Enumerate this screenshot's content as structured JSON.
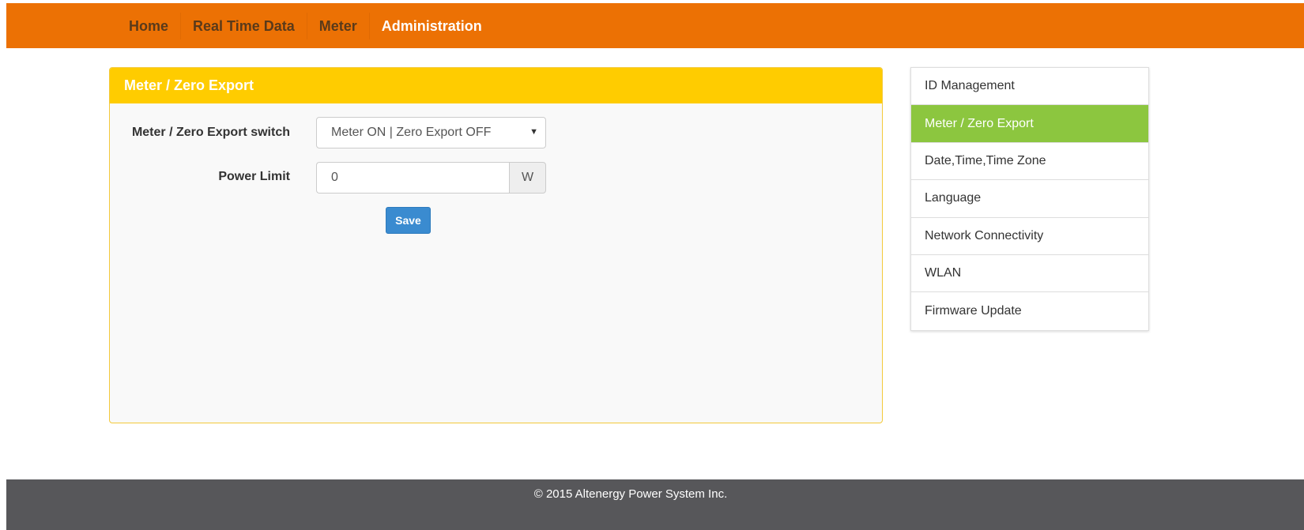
{
  "nav": {
    "items": [
      {
        "label": "Home"
      },
      {
        "label": "Real Time Data"
      },
      {
        "label": "Meter"
      },
      {
        "label": "Administration"
      }
    ],
    "active": "Administration"
  },
  "panel": {
    "title": "Meter / Zero Export",
    "switch_label": "Meter / Zero Export switch",
    "switch_value": "Meter ON | Zero Export OFF",
    "power_limit_label": "Power Limit",
    "power_limit_value": "0",
    "power_limit_unit": "W",
    "save_label": "Save"
  },
  "sidebar": {
    "items": [
      {
        "label": "ID Management"
      },
      {
        "label": "Meter / Zero Export"
      },
      {
        "label": "Date,Time,Time Zone"
      },
      {
        "label": "Language"
      },
      {
        "label": "Network Connectivity"
      },
      {
        "label": "WLAN"
      },
      {
        "label": "Firmware Update"
      }
    ],
    "active": "Meter / Zero Export"
  },
  "footer": {
    "text": "© 2015 Altenergy Power System Inc."
  },
  "colors": {
    "topbar": "#ec7104",
    "panel_heading": "#ffcc00",
    "sidebar_active": "#8cc63f",
    "save_button": "#3a8bd0",
    "footer": "#57575a"
  },
  "icons": {
    "select_arrow": "caret-down-icon"
  }
}
